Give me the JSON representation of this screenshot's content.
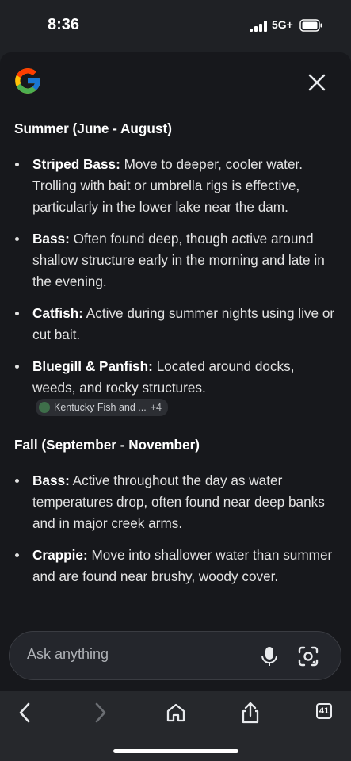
{
  "status": {
    "time": "8:36",
    "network": "5G+"
  },
  "header": {
    "logo_icon": "google-g-icon",
    "close_icon": "close-icon"
  },
  "sections": [
    {
      "title": "Summer (June - August)",
      "items": [
        {
          "title": "Striped Bass:",
          "text": " Move to deeper, cooler water. Trolling with bait or umbrella rigs is effective, particularly in the lower lake near the dam."
        },
        {
          "title": "Bass:",
          "text": " Often found deep, though active around shallow structure early in the morning and late in the evening."
        },
        {
          "title": "Catfish:",
          "text": " Active during summer nights using live or cut bait."
        },
        {
          "title": "Bluegill & Panfish:",
          "text": " Located around docks, weeds, and rocky structures."
        }
      ],
      "source_chip": {
        "label": "Kentucky Fish and ...",
        "count": "+4"
      }
    },
    {
      "title": "Fall (September - November)",
      "items": [
        {
          "title": "Bass:",
          "text": " Active throughout the day as water temperatures drop, often found near deep banks and in major creek arms."
        },
        {
          "title": "Crappie:",
          "text": " Move into shallower water than summer and are found near brushy, woody cover."
        }
      ]
    }
  ],
  "ask_bar": {
    "placeholder": "Ask anything",
    "mic_icon": "microphone-icon",
    "lens_icon": "camera-lens-icon"
  },
  "browser_nav": {
    "back_icon": "back-arrow-icon",
    "forward_icon": "forward-arrow-icon",
    "home_icon": "home-icon",
    "share_icon": "share-icon",
    "tabs_count": "41"
  }
}
